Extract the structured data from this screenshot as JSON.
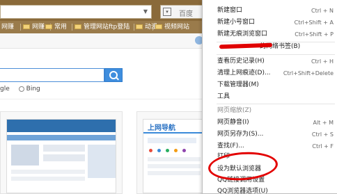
{
  "toolbar": {
    "search_placeholder": "百度",
    "engine_icon": "engine-selector-icon",
    "dropdown_icon": "chevron-down-icon"
  },
  "bookmarks": [
    {
      "label": "网赚",
      "icon": "folder-icon"
    },
    {
      "label": "网赚",
      "icon": "folder-icon"
    },
    {
      "label": "常用",
      "icon": "folder-icon"
    },
    {
      "label": "管理网站ftp登陆",
      "icon": "folder-icon"
    },
    {
      "label": "动漫",
      "icon": "folder-icon"
    },
    {
      "label": "视频网站",
      "icon": "folder-icon"
    }
  ],
  "page": {
    "engine_partial": "gle",
    "engine_bing": "Bing",
    "tile2_logo": "上网导航"
  },
  "menu": {
    "items": [
      {
        "label": "新建窗口",
        "shortcut": "Ctrl + N"
      },
      {
        "label": "新建小号窗口",
        "shortcut": "Ctrl+Shift + A"
      },
      {
        "label": "新建无痕浏览窗口",
        "shortcut": "Ctrl+Shift + P"
      },
      {
        "label": "的网络书签(B)",
        "shortcut": ""
      },
      {
        "label": "查看历史记录(H)",
        "shortcut": "Ctrl + H"
      },
      {
        "label": "清理上网痕迹(D)...",
        "shortcut": "Ctrl+Shift+Delete"
      },
      {
        "label": "下载管理器(M)",
        "shortcut": ""
      },
      {
        "label": "工具",
        "shortcut": ""
      },
      {
        "label": "网页缩放(Z)",
        "shortcut": ""
      },
      {
        "label": "网页静音(I)",
        "shortcut": "Alt + M"
      },
      {
        "label": "网页另存为(S)...",
        "shortcut": "Ctrl + S"
      },
      {
        "label": "查找(F)...",
        "shortcut": "Ctrl + F"
      },
      {
        "label": "打印",
        "shortcut": ""
      },
      {
        "label": "设为默认浏览器",
        "shortcut": ""
      },
      {
        "label": "QQ链接调用设置",
        "shortcut": ""
      },
      {
        "label": "QQ浏览器选项(U)",
        "shortcut": ""
      }
    ]
  },
  "colors": {
    "chrome": "#8a6a3a",
    "bookmark_bar": "#9a7b4b",
    "accent_blue": "#3f8ede",
    "annotation_red": "#e30000"
  }
}
